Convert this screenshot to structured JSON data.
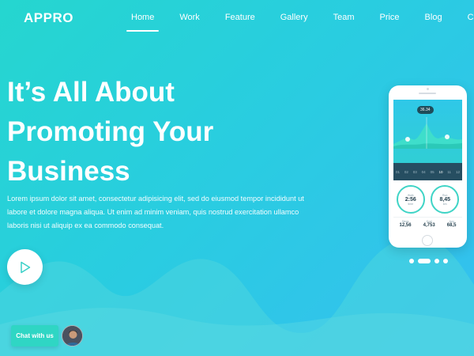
{
  "header": {
    "logo": "APPRO",
    "nav": [
      "Home",
      "Work",
      "Feature",
      "Gallery",
      "Team",
      "Price",
      "Blog",
      "Contact"
    ],
    "active_index": 0
  },
  "hero": {
    "title_line1": "It’s All About",
    "title_line2": "Promoting Your",
    "title_line3": "Business",
    "text": "Lorem ipsum dolor sit amet, consectetur adipisicing elit, sed do eiusmod tempor incididunt ut labore et dolore magna aliqua. Ut enim ad minim veniam, quis nostrud exercitation ullamco laboris nisi ut aliquip ex ea commodo consequat."
  },
  "phone_screen": {
    "pill": "36.34",
    "days": [
      "01",
      "02",
      "03",
      "04",
      "05",
      "10",
      "11",
      "12"
    ],
    "gauges": [
      {
        "label": "Walk",
        "value": "2:56",
        "sub": "time"
      },
      {
        "label": "Run",
        "value": "8,45",
        "sub": "km"
      }
    ],
    "stats": [
      {
        "label": "Steps",
        "value": "12,56"
      },
      {
        "label": "Kcal",
        "value": "4,753"
      },
      {
        "label": "Avg",
        "value": "68,5"
      }
    ]
  },
  "carousel": {
    "count": 4,
    "active_index": 1
  },
  "chat": {
    "label": "Chat with us"
  },
  "colors": {
    "gradient_start": "#25d6cf",
    "gradient_end": "#35bff0",
    "accent": "#2fd6c4",
    "play_icon": "#3ad0c8"
  },
  "icons": {
    "play": "play-icon",
    "avatar": "avatar"
  }
}
